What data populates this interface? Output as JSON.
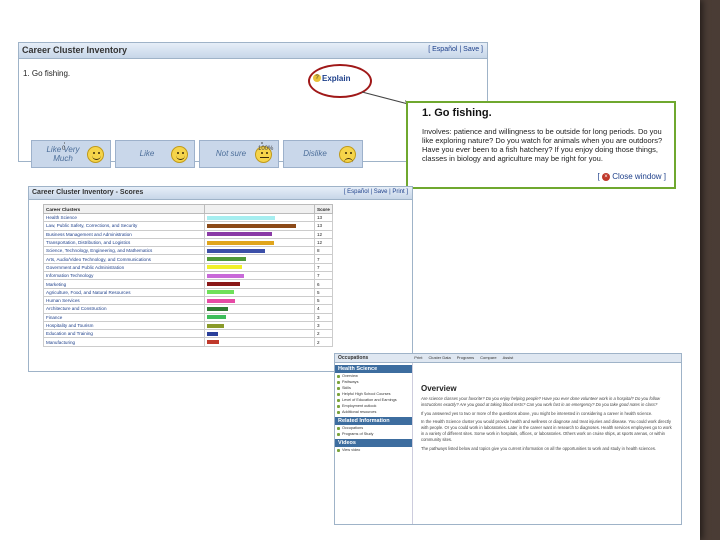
{
  "inventory": {
    "title": "Career Cluster Inventory",
    "lang_links": "[ Español | Save ]",
    "question": "1. Go fishing.",
    "explain_label": "Explain",
    "choices": [
      {
        "label": "Like Very Much",
        "face": "happy"
      },
      {
        "label": "Like",
        "face": "happy"
      },
      {
        "label": "Not sure",
        "face": "neutral"
      },
      {
        "label": "Dislike",
        "face": "sad"
      }
    ],
    "scale_min": "0",
    "scale_max": "100%"
  },
  "popup": {
    "heading": "1. Go fishing.",
    "body": "Involves: patience and willingness to be outside for long periods. Do you like exploring nature? Do you watch for animals when you are outdoors? Have you ever been to a fish hatchery? If you enjoy doing those things, classes in biology and agriculture may be right for you.",
    "close_label": "Close window"
  },
  "scores": {
    "title": "Career Cluster Inventory - Scores",
    "lang_links": "[ Español | Save | Print ]",
    "col_cluster": "Career Clusters",
    "col_score": "Score",
    "rows": [
      {
        "name": "Health Science",
        "score": "13",
        "color": "#a6eef0",
        "fill": 0.65
      },
      {
        "name": "Law, Public Safety, Corrections, and Security",
        "score": "13",
        "color": "#8b4a18",
        "fill": 0.85
      },
      {
        "name": "Business Management and Administration",
        "score": "12",
        "color": "#8a3aa6",
        "fill": 0.62
      },
      {
        "name": "Transportation, Distribution, and Logistics",
        "score": "12",
        "color": "#e0a51c",
        "fill": 0.64
      },
      {
        "name": "Science, Technology, Engineering, and Mathematics",
        "score": "8",
        "color": "#3c4fa8",
        "fill": 0.55
      },
      {
        "name": "Arts, Audio/Video Technology, and Communications",
        "score": "7",
        "color": "#4f9a38",
        "fill": 0.37
      },
      {
        "name": "Government and Public Administration",
        "score": "7",
        "color": "#f0f02a",
        "fill": 0.33
      },
      {
        "name": "Information Technology",
        "score": "7",
        "color": "#c86ad8",
        "fill": 0.35
      },
      {
        "name": "Marketing",
        "score": "6",
        "color": "#8a1818",
        "fill": 0.31
      },
      {
        "name": "Agriculture, Food, and Natural Resources",
        "score": "5",
        "color": "#6fe05a",
        "fill": 0.26
      },
      {
        "name": "Human Services",
        "score": "5",
        "color": "#e64aa5",
        "fill": 0.27
      },
      {
        "name": "Architecture and Construction",
        "score": "4",
        "color": "#2e7d32",
        "fill": 0.2
      },
      {
        "name": "Finance",
        "score": "3",
        "color": "#3dbd5a",
        "fill": 0.18
      },
      {
        "name": "Hospitality and Tourism",
        "score": "3",
        "color": "#8a9a2a",
        "fill": 0.16
      },
      {
        "name": "Education and Training",
        "score": "2",
        "color": "#2a3f9a",
        "fill": 0.1
      },
      {
        "name": "Manufacturing",
        "score": "2",
        "color": "#c0392b",
        "fill": 0.11
      }
    ]
  },
  "health": {
    "tabs": [
      "Occupations",
      "Print",
      "Cluster Data",
      "Programs",
      "Compare",
      "Assist"
    ],
    "section_title": "Health Science",
    "side_items_1": [
      "Overview",
      "Pathways",
      "Skills",
      "Helpful High School Courses",
      "Level of Education and Earnings",
      "Employment outlook",
      "Additional resources"
    ],
    "section_2": "Related Information",
    "side_items_2": [
      "Occupations",
      "Programs of Study"
    ],
    "section_3": "Videos",
    "side_items_3": [
      "View video"
    ],
    "overview_title": "Overview",
    "questions": "Are science classes your favorite? Do you enjoy helping people? Have you ever done volunteer work in a hospital? Do you follow instructions exactly? Are you good at taking blood tests? Can you work fast in an emergency? Do you take good notes in class?",
    "para1": "If you answered yes to two or more of the questions above, you might be interested in considering a career in health science.",
    "para2": "In the Health Science cluster you would provide health and wellness or diagnose and treat injuries and disease. You could work directly with people. Or you could work in laboratories. Later in the career want in research to diagnoses. Health services employees go to work in a variety of different sites. Some work in hospitals, offices, or laboratories. Others work on cruise ships, at sports arenas, or within community sites.",
    "para3": "The pathways listed below and topics give you current information on all the opportunities to work and study in health sciences."
  }
}
